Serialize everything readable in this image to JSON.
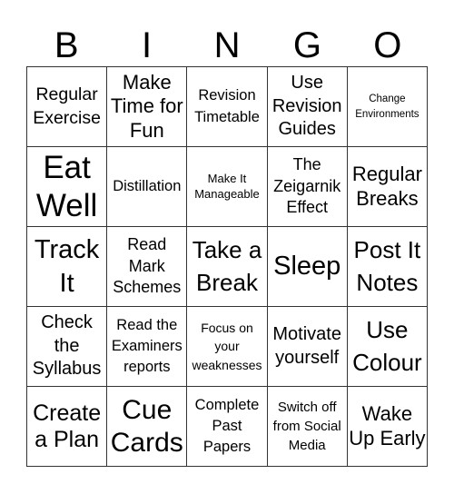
{
  "header": {
    "letters": [
      "B",
      "I",
      "N",
      "G",
      "O"
    ]
  },
  "grid": {
    "cells": [
      "Regular Exercise",
      "Make Time for Fun",
      "Revision Timetable",
      "Use Revision Guides",
      "Change Environments",
      "Eat Well",
      "Distillation",
      "Make It Manageable",
      "The Zeigarnik Effect",
      "Regular Breaks",
      "Track It",
      "Read Mark Schemes",
      "Take a Break",
      "Sleep",
      "Post It Notes",
      "Check the Syllabus",
      "Read the Examiners reports",
      "Focus on your weaknesses",
      "Motivate yourself",
      "Use Colour",
      "Create a Plan",
      "Cue Cards",
      "Complete Past Papers",
      "Switch off from Social Media",
      "Wake Up Early"
    ]
  }
}
